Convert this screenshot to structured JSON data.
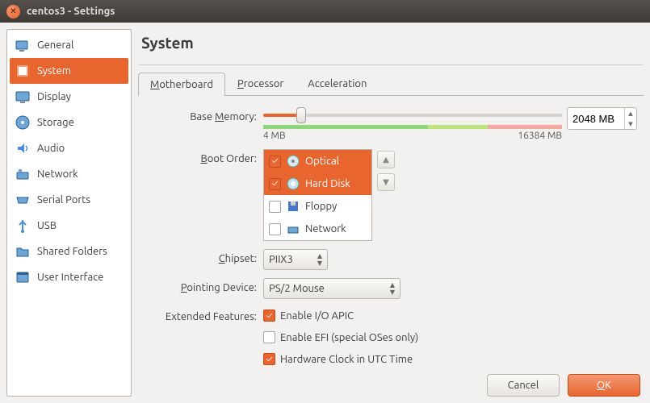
{
  "window": {
    "title": "centos3 - Settings"
  },
  "sidebar": {
    "items": [
      {
        "label": "General"
      },
      {
        "label": "System"
      },
      {
        "label": "Display"
      },
      {
        "label": "Storage"
      },
      {
        "label": "Audio"
      },
      {
        "label": "Network"
      },
      {
        "label": "Serial Ports"
      },
      {
        "label": "USB"
      },
      {
        "label": "Shared Folders"
      },
      {
        "label": "User Interface"
      }
    ]
  },
  "page": {
    "title": "System"
  },
  "tabs": {
    "motherboard": "Motherboard",
    "processor": "Processor",
    "acceleration": "Acceleration"
  },
  "memory": {
    "label": "Base Memory:",
    "value": "2048 MB",
    "min": "4 MB",
    "max": "16384 MB"
  },
  "boot": {
    "label": "Boot Order:",
    "items": [
      {
        "label": "Optical",
        "checked": true,
        "selected": true
      },
      {
        "label": "Hard Disk",
        "checked": true,
        "selected": true
      },
      {
        "label": "Floppy",
        "checked": false,
        "selected": false
      },
      {
        "label": "Network",
        "checked": false,
        "selected": false
      }
    ]
  },
  "chipset": {
    "label": "Chipset:",
    "value": "PIIX3"
  },
  "pointing": {
    "label": "Pointing Device:",
    "value": "PS/2 Mouse"
  },
  "features": {
    "label": "Extended Features:",
    "ioapic": {
      "checked": true,
      "label": "Enable I/O APIC"
    },
    "efi": {
      "checked": false,
      "label": "Enable EFI (special OSes only)"
    },
    "utc": {
      "checked": true,
      "label": "Hardware Clock in UTC Time"
    }
  },
  "buttons": {
    "cancel": "Cancel",
    "ok": "OK"
  }
}
